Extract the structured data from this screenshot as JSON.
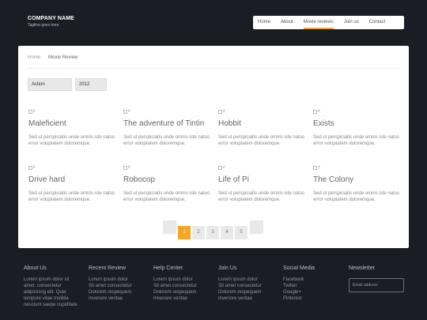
{
  "brand": {
    "name": "COMPANY NAME",
    "tagline": "Tagline goes here"
  },
  "nav": [
    "Home",
    "About",
    "Movie reviews",
    "Join us",
    "Contact"
  ],
  "nav_active": "Movie reviews",
  "accent_color": "#f5a623",
  "breadcrumb": [
    "Home",
    "Movie Review"
  ],
  "filters": {
    "genre": "Action",
    "year": "2012"
  },
  "movies": [
    {
      "alt": "#",
      "title": "Maleficient",
      "desc": "Sed ut perspiciatis unde omnis iste natus error voluptatem doloremque."
    },
    {
      "alt": "#",
      "title": "The adventure of Tintin",
      "desc": "Sed ut perspiciatis unde omnis iste natus error voluptatem doloremque."
    },
    {
      "alt": "#",
      "title": "Hobbit",
      "desc": "Sed ut perspiciatis unde omnis iste natus error voluptatem doloremque."
    },
    {
      "alt": "#",
      "title": "Exists",
      "desc": "Sed ut perspiciatis unde omnis iste natus error voluptatem doloremque."
    },
    {
      "alt": "#",
      "title": "Drive hard",
      "desc": "Sed ut perspiciatis unde omnis iste natus error voluptatem doloremque."
    },
    {
      "alt": "#",
      "title": "Robocop",
      "desc": "Sed ut perspiciatis unde omnis iste natus error voluptatem doloremque."
    },
    {
      "alt": "#",
      "title": "Life of Pi",
      "desc": "Sed ut perspiciatis unde omnis iste natus error voluptatem doloremque."
    },
    {
      "alt": "#",
      "title": "The Colony",
      "desc": "Sed ut perspiciatis unde omnis iste natus error voluptatem doloremque."
    }
  ],
  "pagination": {
    "pages": [
      "1",
      "2",
      "3",
      "4",
      "5"
    ],
    "current": "1"
  },
  "footer": {
    "about": {
      "heading": "About Us",
      "text": "Lorem ipsum dolor sit amet, consectetur adipisicing elit. Quia tempore vitae mollitia nesciunt saepe cupiditate"
    },
    "recent": {
      "heading": "Recent Review",
      "lines": [
        "Lorem ipsum dolor",
        "Sit amet consectetur",
        "Dolorem respequem",
        "Invenore veritae"
      ]
    },
    "help": {
      "heading": "Help Center",
      "lines": [
        "Lorem ipsum dolor",
        "Sit amet consectetur",
        "Dolorem respequem",
        "Invenore veritae"
      ]
    },
    "join": {
      "heading": "Join Us",
      "lines": [
        "Lorem ipsum dolor",
        "Sit amet consectetur",
        "Dolorem respequem",
        "Invenore veritae"
      ]
    },
    "social": {
      "heading": "Social Media",
      "lines": [
        "Facebook",
        "Twitter",
        "Google+",
        "Pinterest"
      ]
    },
    "newsletter": {
      "heading": "Newsletter",
      "placeholder": "Email address"
    }
  }
}
